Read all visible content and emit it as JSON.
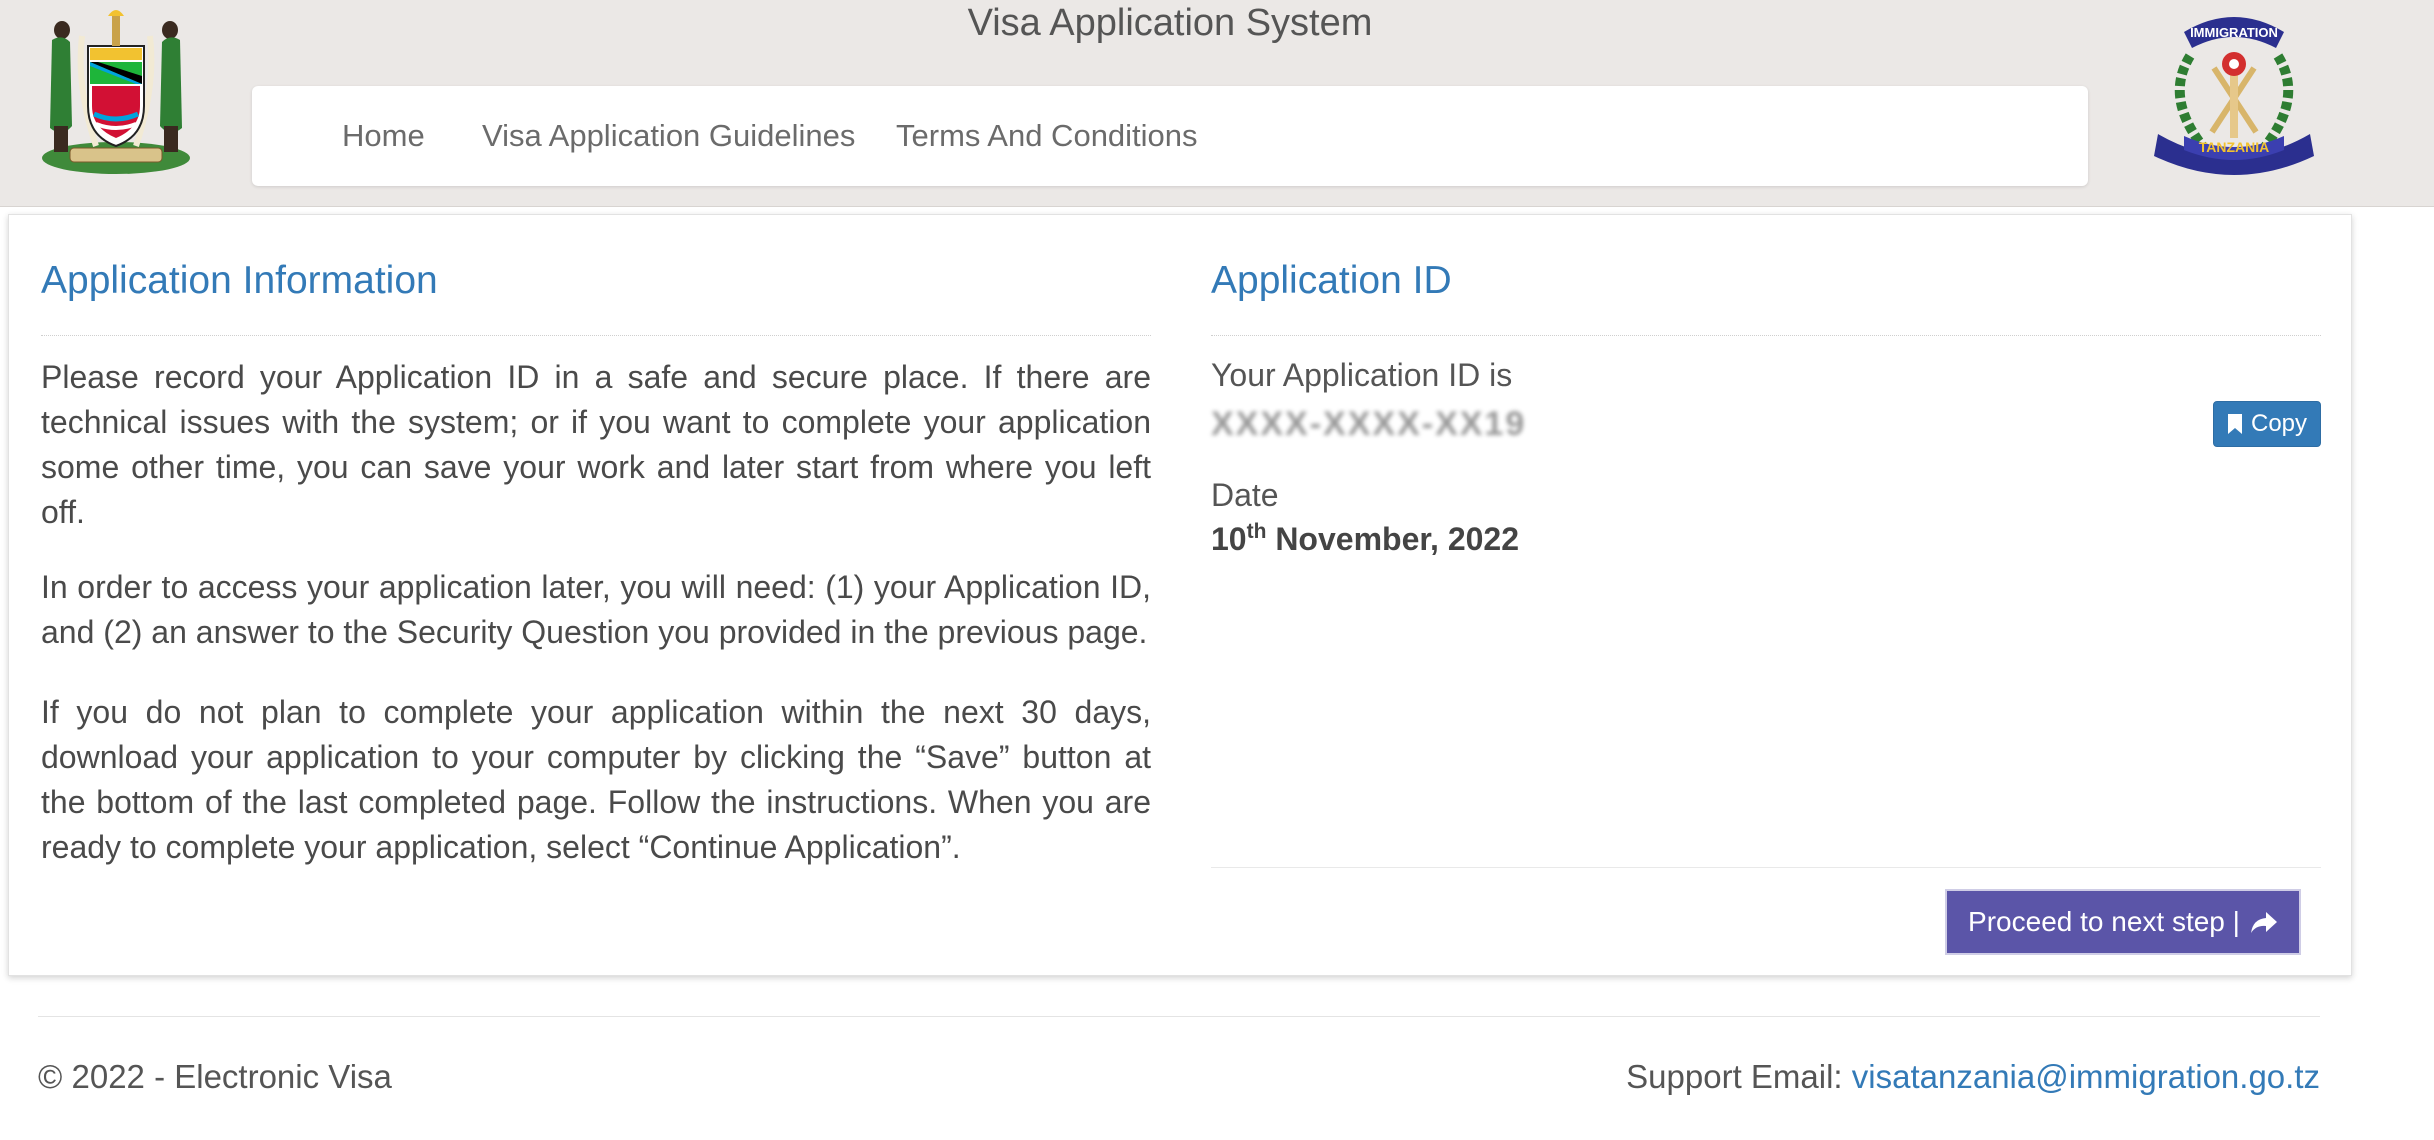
{
  "header": {
    "title": "Visa Application System",
    "left_logo_icon": "tanzania-coat-of-arms-icon",
    "right_logo_icon": "immigration-tanzania-emblem-icon",
    "right_logo_text_top": "IMMIGRATION",
    "right_logo_text_bottom": "TANZANIA"
  },
  "nav": {
    "items": [
      {
        "label": "Home"
      },
      {
        "label": "Visa Application Guidelines"
      },
      {
        "label": "Terms And Conditions"
      }
    ]
  },
  "info": {
    "title": "Application Information",
    "paragraphs": [
      "Please record your Application ID in a safe and secure place. If there are technical issues with the system; or if you want to complete your application some other time, you can save your work and later start from where you left off.",
      "In order to access your application later, you will need: (1) your Application ID, and (2) an answer to the Security Question you provided in the previous page.",
      "If you do not plan to complete your application within the next 30 days, download your application to your computer by clicking the “Save” button at the bottom of the last completed page. Follow the instructions. When you are ready to complete your application, select “Continue Application”."
    ]
  },
  "appid": {
    "title": "Application ID",
    "id_label": "Your Application ID is",
    "id_value": "XXXX-XXXX-XX19",
    "copy_label": "Copy",
    "copy_icon": "bookmark-icon",
    "date_label": "Date",
    "date_day": "10",
    "date_suffix": "th",
    "date_rest": " November, 2022"
  },
  "proceed": {
    "label": "Proceed to next step |",
    "icon": "share-icon"
  },
  "footer": {
    "copyright": "© 2022 - Electronic Visa",
    "support_label": "Support Email: ",
    "support_email": "visatanzania@immigration.go.tz"
  },
  "colors": {
    "header_bg": "#ebe8e6",
    "link_blue": "#337ab7",
    "proceed_purple": "#5b55a8"
  }
}
